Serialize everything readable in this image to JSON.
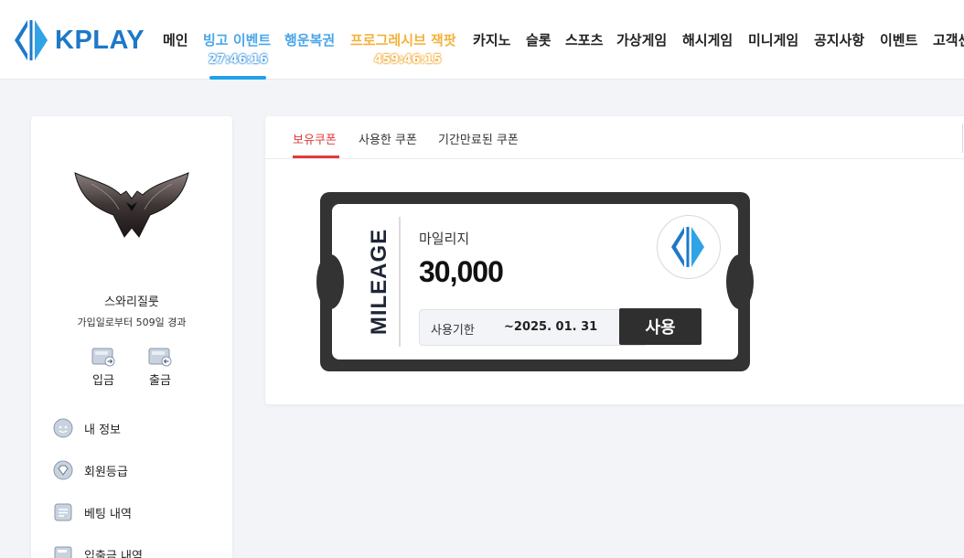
{
  "header": {
    "logo_text": "KPLAY",
    "nav": [
      {
        "label": "메인",
        "style": "normal"
      },
      {
        "label": "빙고 이벤트",
        "style": "bingo",
        "timer": "27:46:16"
      },
      {
        "label": "행운복권",
        "style": "lucky"
      },
      {
        "label": "프로그레시브 잭팟",
        "style": "jackpot",
        "timer": "459:46:15"
      },
      {
        "label": "카지노",
        "style": "normal"
      },
      {
        "label": "슬롯",
        "style": "normal"
      },
      {
        "label": "스포츠",
        "style": "normal"
      },
      {
        "label": "가상게임",
        "style": "normal"
      },
      {
        "label": "해시게임",
        "style": "normal"
      },
      {
        "label": "미니게임",
        "style": "normal"
      },
      {
        "label": "공지사항",
        "style": "normal"
      },
      {
        "label": "이벤트",
        "style": "normal"
      },
      {
        "label": "고객센터",
        "style": "normal"
      }
    ]
  },
  "sidebar": {
    "username": "스와리질룻",
    "join_info": "가입일로부터 509일 경과",
    "deposit_label": "입금",
    "withdraw_label": "출금",
    "menu": [
      {
        "label": "내 정보",
        "icon": "profile-icon"
      },
      {
        "label": "회원등급",
        "icon": "grade-icon"
      },
      {
        "label": "베팅 내역",
        "icon": "betting-history-icon"
      },
      {
        "label": "입출금 내역",
        "icon": "transaction-history-icon"
      }
    ]
  },
  "main": {
    "tabs": [
      {
        "label": "보유쿠폰",
        "active": true
      },
      {
        "label": "사용한 쿠폰",
        "active": false
      },
      {
        "label": "기간만료된 쿠폰",
        "active": false
      }
    ],
    "coupon": {
      "vertical_label": "MILEAGE",
      "type": "마일리지",
      "amount": "30,000",
      "expiry_label": "사용기한",
      "expiry_date": "~2025. 01. 31",
      "use_button": "사용"
    }
  },
  "colors": {
    "brand_blue": "#1f78c8",
    "active_red": "#e23b3b",
    "coupon_dark": "#333333",
    "jackpot_orange": "#f4b23c",
    "bingo_blue": "#4aa6ea"
  }
}
